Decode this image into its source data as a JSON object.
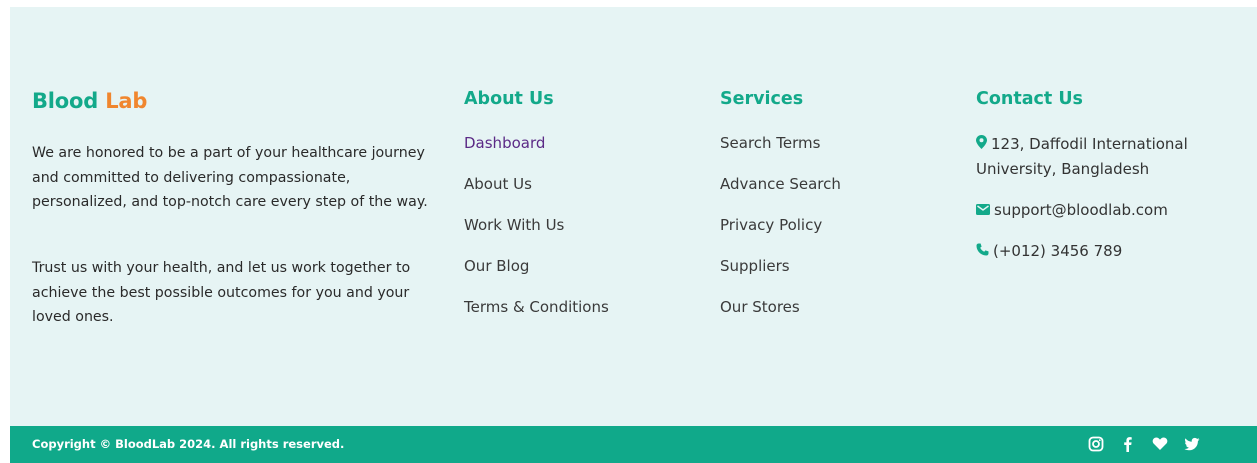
{
  "brand": {
    "part1": "Blood",
    "part2": "Lab",
    "color1": "#13a98a",
    "color2": "#f0862e"
  },
  "intro": {
    "paragraph1": "We are honored to be a part of your healthcare journey and committed to delivering compassionate, personalized, and top-notch care every step of the way.",
    "paragraph2": "Trust us with your health, and let us work together to achieve the best possible outcomes for you and your loved ones."
  },
  "about": {
    "heading": "About Us",
    "links": [
      "Dashboard",
      "About Us",
      "Work With Us",
      "Our Blog",
      "Terms & Conditions"
    ]
  },
  "services": {
    "heading": "Services",
    "links": [
      "Search Terms",
      "Advance Search",
      "Privacy Policy",
      "Suppliers",
      "Our Stores"
    ]
  },
  "contact": {
    "heading": "Contact Us",
    "address": "123, Daffodil International University, Bangladesh",
    "email": "support@bloodlab.com",
    "phone": "(+012) 3456 789",
    "icons": [
      "map-pin-icon",
      "mail-icon",
      "phone-icon"
    ]
  },
  "bottom_bar": {
    "copyright": "Copyright © BloodLab 2024. All rights reserved.",
    "social_icons": [
      "instagram-icon",
      "facebook-icon",
      "heart-icon",
      "twitter-icon"
    ]
  },
  "colors": {
    "accent": "#13a98a",
    "footer_bg": "#e6f4f4",
    "bar_bg": "#10a98a",
    "active_link": "#5b2a86"
  }
}
